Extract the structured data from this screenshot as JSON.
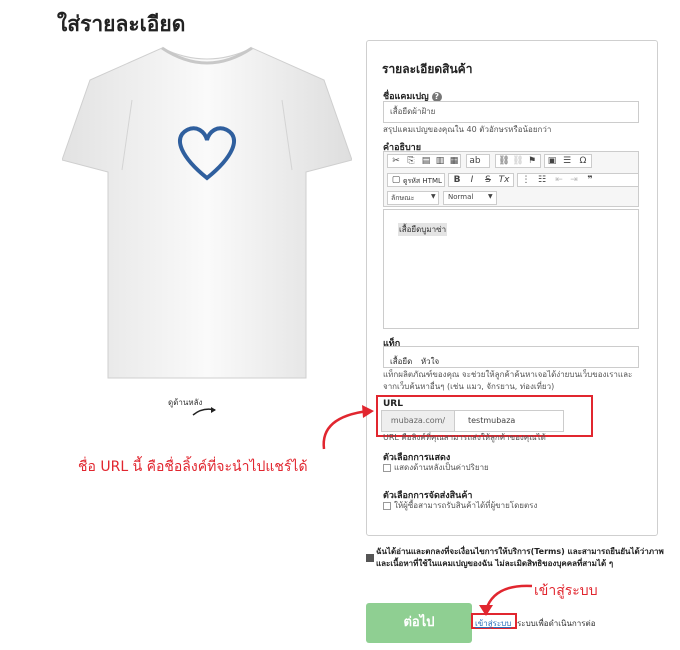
{
  "page": {
    "title": "ใส่รายละเอียด"
  },
  "preview": {
    "back_view_label": "ดูด้านหลัง"
  },
  "panel": {
    "title": "รายละเอียดสินค้า",
    "campaign_name": {
      "label": "ชื่อแคมเปญ",
      "help": "?",
      "value": "เสื้อยืดผ้าฝ้าย",
      "hint": "สรุปแคมเปญของคุณใน 40 ตัวอักษรหรือน้อยกว่า"
    },
    "description": {
      "label": "คำอธิบาย",
      "toolbar": {
        "source_label": "ดูรหัส HTML",
        "format_select": "ลักษณะ",
        "size_select": "Normal"
      },
      "content": "เสื้อยืดบูมาซ่า"
    },
    "tags": {
      "label": "แท็ก",
      "items": [
        "เสื้อยืด",
        "หัวใจ"
      ],
      "hint": "แท็กผลิตภัณฑ์ของคุณ จะช่วยให้ลูกค้าค้นหาเจอได้ง่ายบนเว็บของเราและจากเว็บค้นหาอื่นๆ (เช่น แมว, จักรยาน, ท่องเที่ยว)"
    },
    "url": {
      "label": "URL",
      "prefix": "mubaza.com/",
      "value": "testmubaza",
      "hint": "URL คือลิงค์ที่คุณสามารถส่งให้ลูกค้าของคุณได้"
    },
    "display_options": {
      "label": "ตัวเลือกการแสดง",
      "checkbox_label": "แสดงด้านหลังเป็นค่าปริยาย",
      "checked": false
    },
    "shipping_options": {
      "label": "ตัวเลือกการจัดส่งสินค้า",
      "checkbox_label": "ให้ผู้ซื้อสามารถรับสินค้าได้ที่ผู้ขายโดยตรง",
      "checked": false
    }
  },
  "terms": {
    "text": "ฉันได้อ่านและตกลงที่จะเงื่อนไขการให้บริการ(Terms) และสามารถยืนยันได้ว่าภาพและเนื้อหาที่ใช้ในแคมเปญของฉัน ไม่ละเมิดสิทธิของบุคคลที่สามได้ ๆ",
    "checked": true
  },
  "actions": {
    "next_label": "ต่อไป",
    "login_link": "เข้าสู่ระบบ",
    "login_suffix": "ระบบเพื่อดำเนินการต่อ"
  },
  "annotations": {
    "url_note": "ชื่อ URL นี้ คือชื่อลิ้งค์ที่จะนำไปแชร์ได้",
    "login_note": "เข้าสู่ระบบ"
  },
  "colors": {
    "annotation_red": "#e1262f",
    "next_button": "#8fcf92",
    "link_blue": "#2a6ebb"
  }
}
